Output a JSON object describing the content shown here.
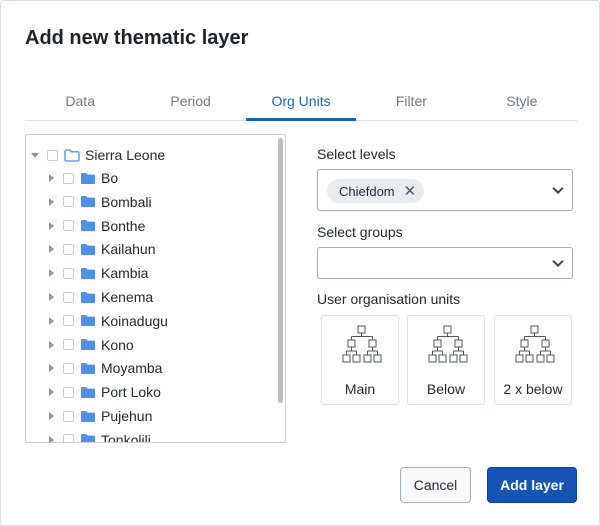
{
  "dialog": {
    "title": "Add new thematic layer"
  },
  "tabs": [
    {
      "label": "Data",
      "active": false
    },
    {
      "label": "Period",
      "active": false
    },
    {
      "label": "Org Units",
      "active": true
    },
    {
      "label": "Filter",
      "active": false
    },
    {
      "label": "Style",
      "active": false
    }
  ],
  "tree": {
    "root": {
      "label": "Sierra Leone",
      "expanded": true,
      "checked": false,
      "icon": "folder-outline-icon"
    },
    "children": [
      {
        "label": "Bo"
      },
      {
        "label": "Bombali"
      },
      {
        "label": "Bonthe"
      },
      {
        "label": "Kailahun"
      },
      {
        "label": "Kambia"
      },
      {
        "label": "Kenema"
      },
      {
        "label": "Koinadugu"
      },
      {
        "label": "Kono"
      },
      {
        "label": "Moyamba"
      },
      {
        "label": "Port Loko"
      },
      {
        "label": "Pujehun"
      },
      {
        "label": "Tonkolili"
      }
    ]
  },
  "levels": {
    "label": "Select levels",
    "selected": [
      "Chiefdom"
    ]
  },
  "groups": {
    "label": "Select groups",
    "selected": []
  },
  "user_org_units": {
    "label": "User organisation units",
    "options": [
      {
        "label": "Main",
        "icon": "org-hierarchy-icon"
      },
      {
        "label": "Below",
        "icon": "org-hierarchy-icon"
      },
      {
        "label": "2 x below",
        "icon": "org-hierarchy-icon"
      }
    ]
  },
  "buttons": {
    "cancel": "Cancel",
    "add": "Add layer"
  },
  "colors": {
    "primary": "#1654b4",
    "tab_active": "#1565c0",
    "folder": "#4f8fe6"
  }
}
